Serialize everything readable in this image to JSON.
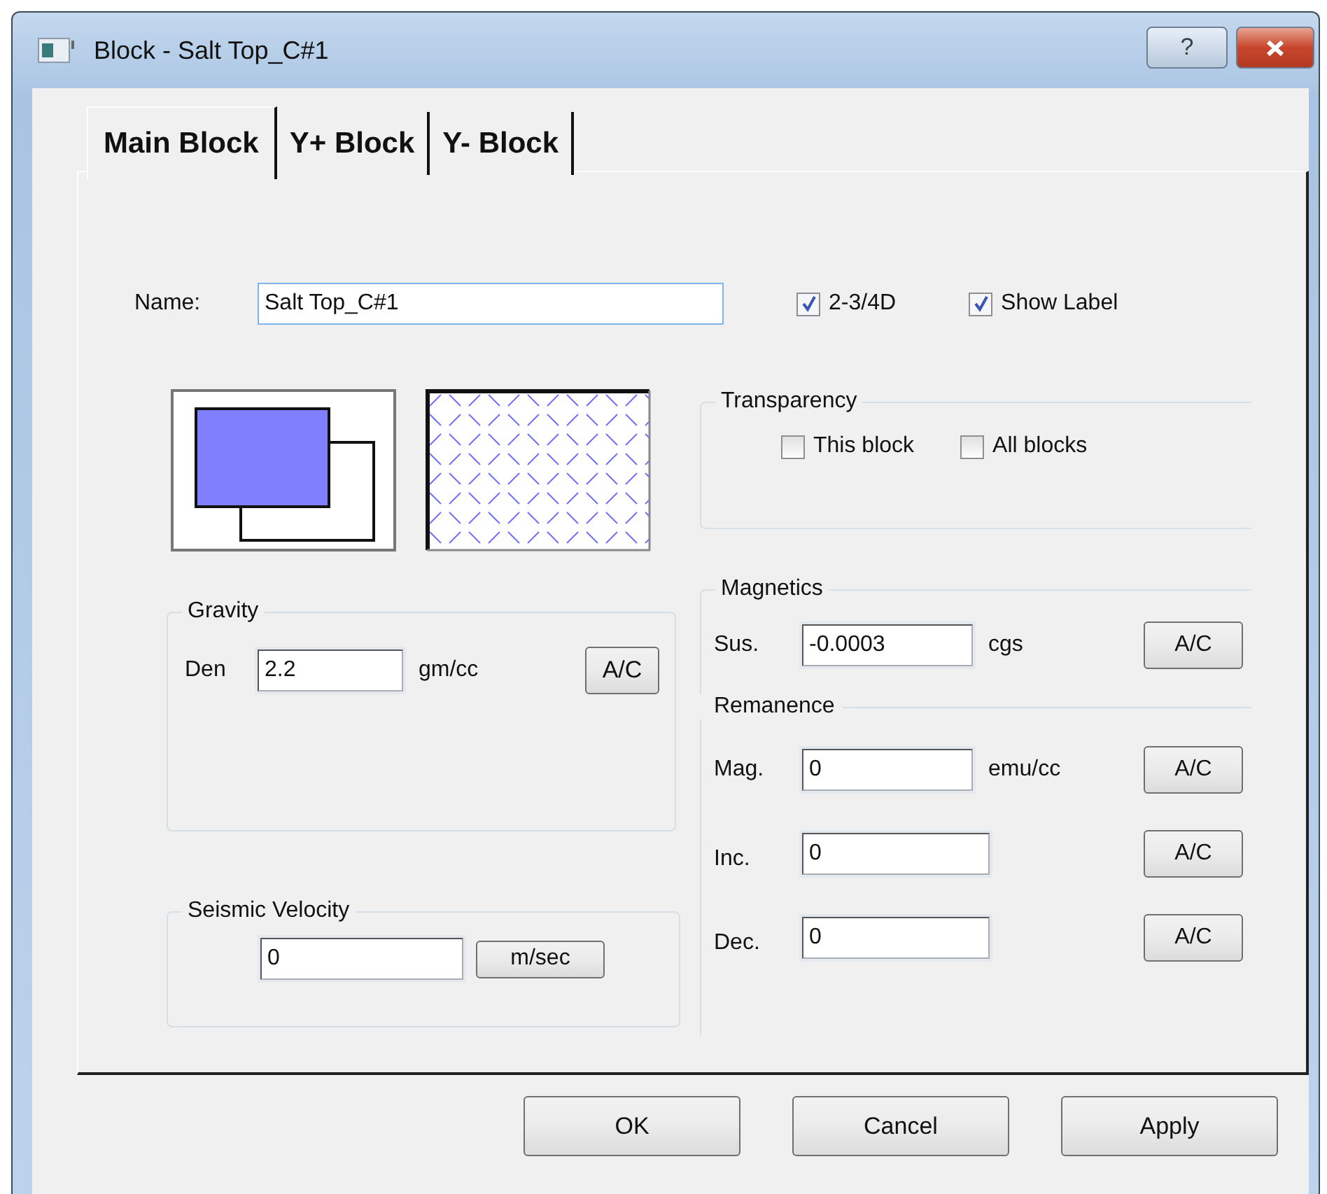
{
  "window": {
    "title": "Block - Salt Top_C#1",
    "help_button": "?"
  },
  "tabs": [
    {
      "label": "Main Block",
      "selected": true
    },
    {
      "label": "Y+ Block",
      "selected": false
    },
    {
      "label": "Y- Block",
      "selected": false
    }
  ],
  "name_field": {
    "label": "Name:",
    "value": "Salt Top_C#1"
  },
  "options": [
    {
      "label": "2-3/4D",
      "checked": true
    },
    {
      "label": "Show Label",
      "checked": true
    }
  ],
  "transparency": {
    "title": "Transparency",
    "options": [
      {
        "label": "This block",
        "checked": false
      },
      {
        "label": "All blocks",
        "checked": false
      }
    ]
  },
  "gravity": {
    "title": "Gravity",
    "label": "Den",
    "value": "2.2",
    "unit": "gm/cc",
    "button": "A/C"
  },
  "seismic": {
    "title": "Seismic Velocity",
    "value": "0",
    "button": "m/sec"
  },
  "magnetics": {
    "title": "Magnetics",
    "rows": [
      {
        "label": "Sus.",
        "value": "-0.0003",
        "unit": "cgs",
        "button": "A/C"
      }
    ]
  },
  "remanence": {
    "title": "Remanence",
    "rows": [
      {
        "label": "Mag.",
        "value": "0",
        "unit": "emu/cc",
        "button": "A/C"
      },
      {
        "label": "Inc.",
        "value": "0",
        "button": "A/C"
      },
      {
        "label": "Dec.",
        "value": "0",
        "button": "A/C"
      }
    ]
  },
  "buttons": [
    "OK",
    "Cancel",
    "Apply"
  ]
}
